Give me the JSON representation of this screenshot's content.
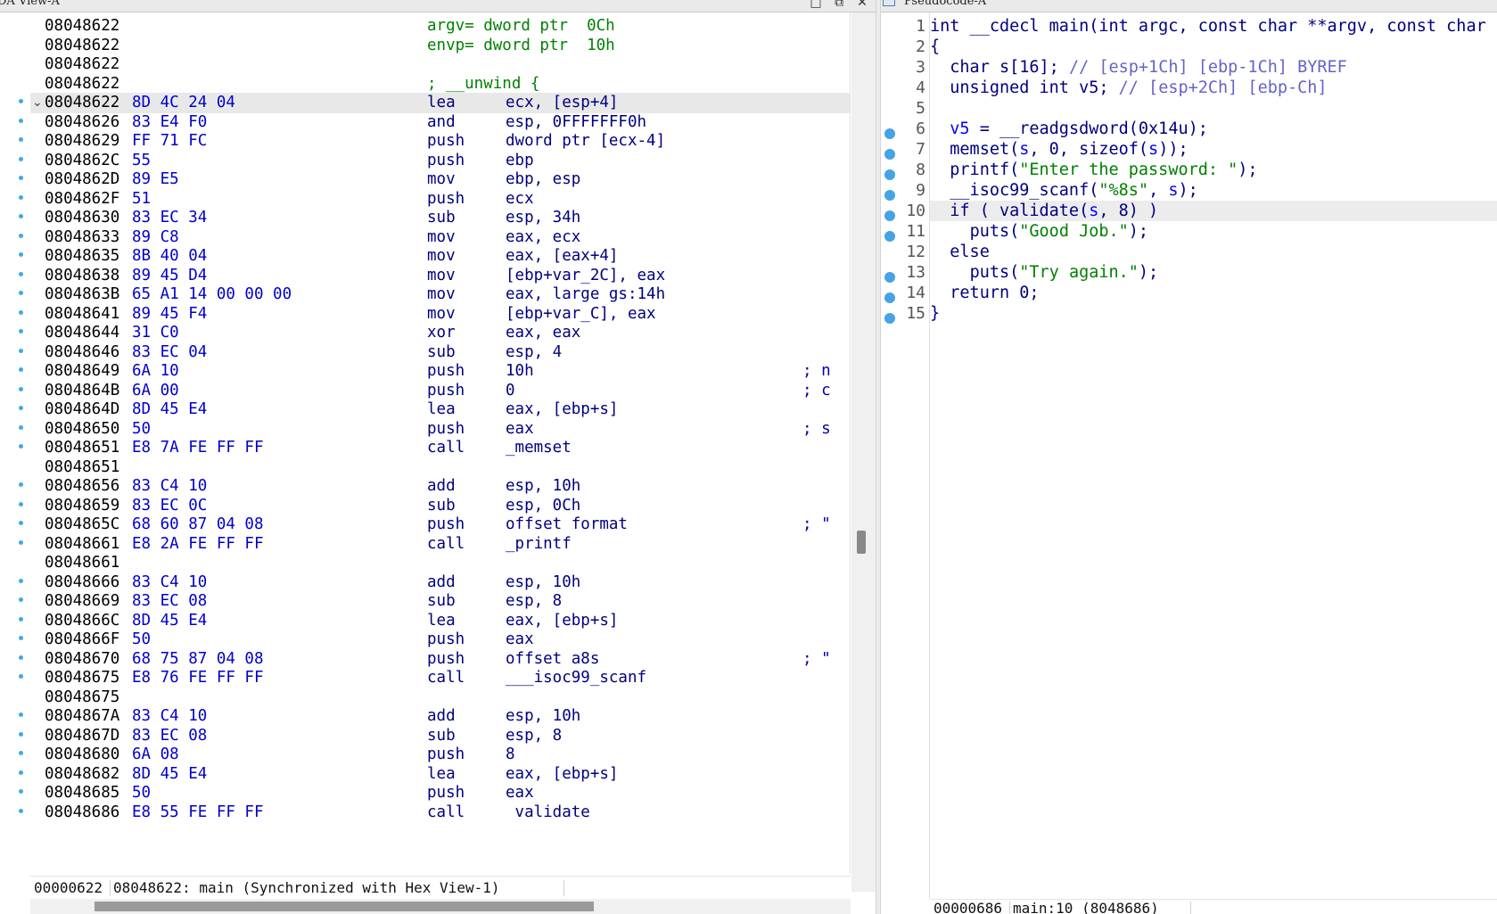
{
  "left_panel": {
    "title": "DA View-A",
    "controls": [
      "□",
      "⧉",
      "✕"
    ],
    "args": [
      {
        "addr": "08048622",
        "text": "argv= dword ptr  0Ch"
      },
      {
        "addr": "08048622",
        "text": "envp= dword ptr  10h"
      },
      {
        "addr": "08048622",
        "text": ""
      },
      {
        "addr": "08048622",
        "text": "; __unwind {"
      }
    ],
    "instructions": [
      {
        "addr": "08048622",
        "bytes": "8D 4C 24 04",
        "mnem": "lea",
        "operands": "ecx, [esp+4]",
        "comment": "",
        "selected": true,
        "fold": "⌄"
      },
      {
        "addr": "08048626",
        "bytes": "83 E4 F0",
        "mnem": "and",
        "operands": "esp, 0FFFFFFF0h",
        "comment": ""
      },
      {
        "addr": "08048629",
        "bytes": "FF 71 FC",
        "mnem": "push",
        "operands": "dword ptr [ecx-4]",
        "comment": ""
      },
      {
        "addr": "0804862C",
        "bytes": "55",
        "mnem": "push",
        "operands": "ebp",
        "comment": ""
      },
      {
        "addr": "0804862D",
        "bytes": "89 E5",
        "mnem": "mov",
        "operands": "ebp, esp",
        "comment": ""
      },
      {
        "addr": "0804862F",
        "bytes": "51",
        "mnem": "push",
        "operands": "ecx",
        "comment": ""
      },
      {
        "addr": "08048630",
        "bytes": "83 EC 34",
        "mnem": "sub",
        "operands": "esp, 34h",
        "comment": ""
      },
      {
        "addr": "08048633",
        "bytes": "89 C8",
        "mnem": "mov",
        "operands": "eax, ecx",
        "comment": ""
      },
      {
        "addr": "08048635",
        "bytes": "8B 40 04",
        "mnem": "mov",
        "operands": "eax, [eax+4]",
        "comment": ""
      },
      {
        "addr": "08048638",
        "bytes": "89 45 D4",
        "mnem": "mov",
        "operands": "[ebp+var_2C], eax",
        "comment": ""
      },
      {
        "addr": "0804863B",
        "bytes": "65 A1 14 00 00 00",
        "mnem": "mov",
        "operands": "eax, large gs:14h",
        "comment": ""
      },
      {
        "addr": "08048641",
        "bytes": "89 45 F4",
        "mnem": "mov",
        "operands": "[ebp+var_C], eax",
        "comment": ""
      },
      {
        "addr": "08048644",
        "bytes": "31 C0",
        "mnem": "xor",
        "operands": "eax, eax",
        "comment": ""
      },
      {
        "addr": "08048646",
        "bytes": "83 EC 04",
        "mnem": "sub",
        "operands": "esp, 4",
        "comment": ""
      },
      {
        "addr": "08048649",
        "bytes": "6A 10",
        "mnem": "push",
        "operands": "10h",
        "comment": "; n"
      },
      {
        "addr": "0804864B",
        "bytes": "6A 00",
        "mnem": "push",
        "operands": "0",
        "comment": "; c"
      },
      {
        "addr": "0804864D",
        "bytes": "8D 45 E4",
        "mnem": "lea",
        "operands": "eax, [ebp+s]",
        "comment": ""
      },
      {
        "addr": "08048650",
        "bytes": "50",
        "mnem": "push",
        "operands": "eax",
        "comment": "; s"
      },
      {
        "addr": "08048651",
        "bytes": "E8 7A FE FF FF",
        "mnem": "call",
        "operands": "_memset",
        "comment": ""
      },
      {
        "addr": "08048651",
        "bytes": "",
        "mnem": "",
        "operands": "",
        "comment": "",
        "blank": true
      },
      {
        "addr": "08048656",
        "bytes": "83 C4 10",
        "mnem": "add",
        "operands": "esp, 10h",
        "comment": ""
      },
      {
        "addr": "08048659",
        "bytes": "83 EC 0C",
        "mnem": "sub",
        "operands": "esp, 0Ch",
        "comment": ""
      },
      {
        "addr": "0804865C",
        "bytes": "68 60 87 04 08",
        "mnem": "push",
        "operands": "offset format",
        "comment": "; \""
      },
      {
        "addr": "08048661",
        "bytes": "E8 2A FE FF FF",
        "mnem": "call",
        "operands": "_printf",
        "comment": ""
      },
      {
        "addr": "08048661",
        "bytes": "",
        "mnem": "",
        "operands": "",
        "comment": "",
        "blank": true
      },
      {
        "addr": "08048666",
        "bytes": "83 C4 10",
        "mnem": "add",
        "operands": "esp, 10h",
        "comment": ""
      },
      {
        "addr": "08048669",
        "bytes": "83 EC 08",
        "mnem": "sub",
        "operands": "esp, 8",
        "comment": ""
      },
      {
        "addr": "0804866C",
        "bytes": "8D 45 E4",
        "mnem": "lea",
        "operands": "eax, [ebp+s]",
        "comment": ""
      },
      {
        "addr": "0804866F",
        "bytes": "50",
        "mnem": "push",
        "operands": "eax",
        "comment": ""
      },
      {
        "addr": "08048670",
        "bytes": "68 75 87 04 08",
        "mnem": "push",
        "operands": "offset a8s",
        "comment": "; \""
      },
      {
        "addr": "08048675",
        "bytes": "E8 76 FE FF FF",
        "mnem": "call",
        "operands": "___isoc99_scanf",
        "comment": ""
      },
      {
        "addr": "08048675",
        "bytes": "",
        "mnem": "",
        "operands": "",
        "comment": "",
        "blank": true
      },
      {
        "addr": "0804867A",
        "bytes": "83 C4 10",
        "mnem": "add",
        "operands": "esp, 10h",
        "comment": ""
      },
      {
        "addr": "0804867D",
        "bytes": "83 EC 08",
        "mnem": "sub",
        "operands": "esp, 8",
        "comment": ""
      },
      {
        "addr": "08048680",
        "bytes": "6A 08",
        "mnem": "push",
        "operands": "8",
        "comment": ""
      },
      {
        "addr": "08048682",
        "bytes": "8D 45 E4",
        "mnem": "lea",
        "operands": "eax, [ebp+s]",
        "comment": ""
      },
      {
        "addr": "08048685",
        "bytes": "50",
        "mnem": "push",
        "operands": "eax",
        "comment": ""
      },
      {
        "addr": "08048686",
        "bytes": "E8 55 FE FF FF",
        "mnem": "call",
        "operands": " validate",
        "comment": ""
      }
    ],
    "status": {
      "offset": "00000622",
      "location": "08048622: main (Synchronized with Hex View-1)"
    }
  },
  "right_panel": {
    "title": "Pseudocode-A",
    "status": {
      "offset": "00000686",
      "location": "main:10 (8048686)"
    }
  },
  "colors": {
    "breakpoint_dot": "#45a3e6",
    "string": "#008000",
    "keyword": "#000080",
    "variable": "#0000ff",
    "comment": "#6464c8",
    "selected_line": "#ececec"
  }
}
